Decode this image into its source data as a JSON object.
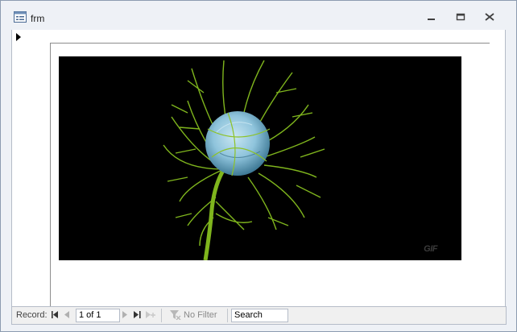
{
  "window": {
    "title": "frm",
    "icon": "form-icon",
    "controls": [
      "minimize-icon",
      "restore-icon",
      "close-icon"
    ]
  },
  "form": {
    "picture": {
      "subject": "green spiky flower bud with blue pod on black background",
      "watermark": "GIF"
    }
  },
  "navigation": {
    "record_label": "Record:",
    "current_record": "1 of 1",
    "filter_label": "No Filter",
    "search_value": "Search"
  },
  "colors": {
    "window_bg": "#eef1f6",
    "picture_bg": "#000000",
    "stem_green": "#7fb51d",
    "bud_blue": "#8fc4dc"
  }
}
